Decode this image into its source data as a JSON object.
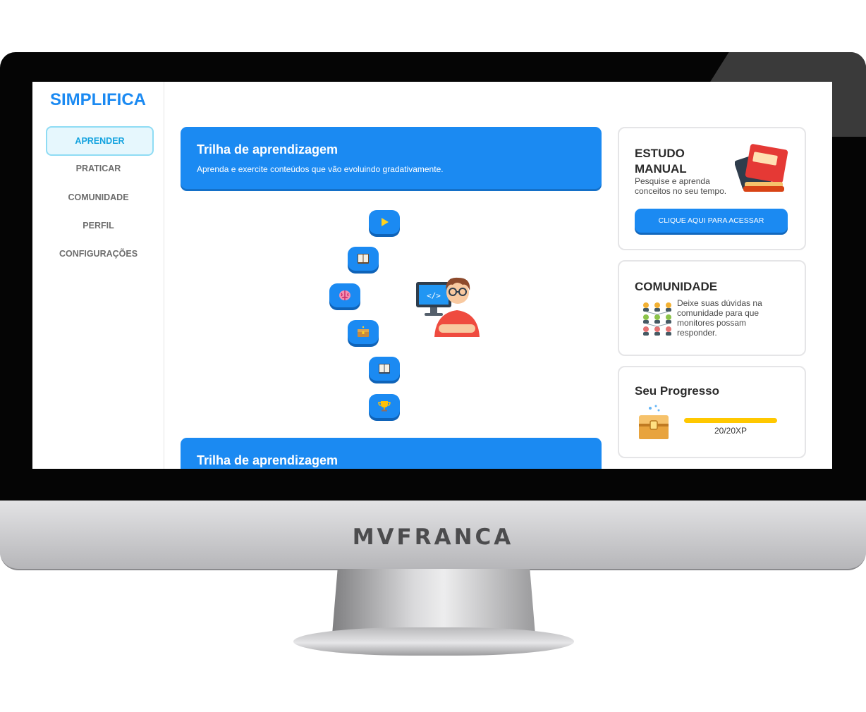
{
  "app": {
    "logo": "SIMPLIFICA"
  },
  "sidebar": {
    "items": [
      {
        "label": "APRENDER",
        "active": true
      },
      {
        "label": "PRATICAR"
      },
      {
        "label": "COMUNIDADE"
      },
      {
        "label": "PERFIL"
      },
      {
        "label": "CONFIGURAÇÕES"
      }
    ]
  },
  "main": {
    "trails": [
      {
        "title": "Trilha de aprendizagem",
        "subtitle": "Aprenda e exercite conteúdos que vão evoluindo gradativamente."
      },
      {
        "title": "Trilha de aprendizagem"
      }
    ],
    "path_nodes": [
      "play-icon",
      "book-icon",
      "brain-icon",
      "chest-icon",
      "book-icon",
      "trophy-icon"
    ]
  },
  "cards": {
    "study": {
      "title_line1": "ESTUDO",
      "title_line2": "MANUAL",
      "text_line1": "Pesquise e aprenda",
      "text_line2": "conceitos no seu tempo.",
      "button": "CLIQUE AQUI PARA ACESSAR"
    },
    "community": {
      "title": "COMUNIDADE",
      "text_line1": "Deixe suas dúvidas na",
      "text_line2": "comunidade para que",
      "text_line3": "monitores possam",
      "text_line4": "responder."
    },
    "progress": {
      "title": "Seu Progresso",
      "xp_label": "20/20XP",
      "progress_fraction": 1.0
    }
  },
  "device": {
    "brand": "MVFRANCA"
  },
  "colors": {
    "primary": "#1b8af2",
    "active_nav": "#14a3df",
    "progress": "#ffc800"
  }
}
